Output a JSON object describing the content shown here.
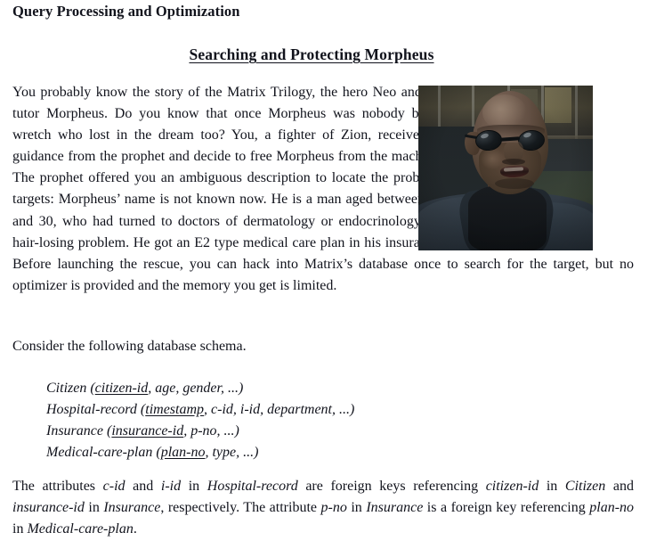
{
  "document": {
    "running_header": "Query Processing and Optimization",
    "title": "Searching and Protecting Morpheus"
  },
  "paragraph1": {
    "text": "You probably know the story of the Matrix Trilogy, the hero Neo and his tutor Morpheus. Do you know that once Morpheus was nobody but a wretch who lost in the dream too? You, a fighter of Zion, receive the guidance from the prophet and decide to free Morpheus from the machine.  The prophet offered you an ambiguous description to locate the probable targets: Morpheus’ name is not known now. He is a man aged between 20 and 30, who had turned to doctors of dermatology or endocrinology for hair-losing problem. He got an E2 type medical care plan in his insurance. Before launching the rescue, you can hack into Matrix’s database once to search for the target, but no optimizer is provided and the memory you get is limited."
  },
  "photo": {
    "alt": "Morpheus wearing round dark sunglasses and a long dark coat, standing in front of a building"
  },
  "schema_intro": "Consider the following database schema.",
  "schema": {
    "relations": [
      {
        "name": "Citizen",
        "open": " (",
        "key": "citizen-id",
        "rest": ", age, gender, ...)"
      },
      {
        "name": "Hospital-record",
        "open": " (",
        "key": "timestamp",
        "rest": ", c-id, i-id, department, ...)"
      },
      {
        "name": "Insurance",
        "open": " (",
        "key": "insurance-id",
        "rest": ", p-no, ...)"
      },
      {
        "name": "Medical-care-plan",
        "open": " (",
        "key": "plan-no",
        "rest": ", type, ...)"
      }
    ]
  },
  "foreign_keys": {
    "t1": "The attributes ",
    "attr_c_id": "c-id",
    "t2": " and ",
    "attr_i_id": "i-id",
    "t3": " in ",
    "rel_hospital_record": "Hospital-record",
    "t4": " are foreign keys referencing ",
    "attr_citizen_id": "citizen-id",
    "t5": " in ",
    "rel_citizen": "Citizen",
    "t6": " and ",
    "attr_insurance_id": "insurance-id",
    "t7": " in ",
    "rel_insurance": "Insurance",
    "t8": ", respectively. The attribute ",
    "attr_p_no": "p-no",
    "t9": " in ",
    "rel_insurance2": "Insurance",
    "t10": " is a foreign key referencing ",
    "attr_plan_no": "plan-no",
    "t11": " in ",
    "rel_medical_care_plan": "Medical-care-plan",
    "t12": "."
  },
  "colors": {
    "text": "#11131c",
    "page_background": "#ffffff"
  }
}
